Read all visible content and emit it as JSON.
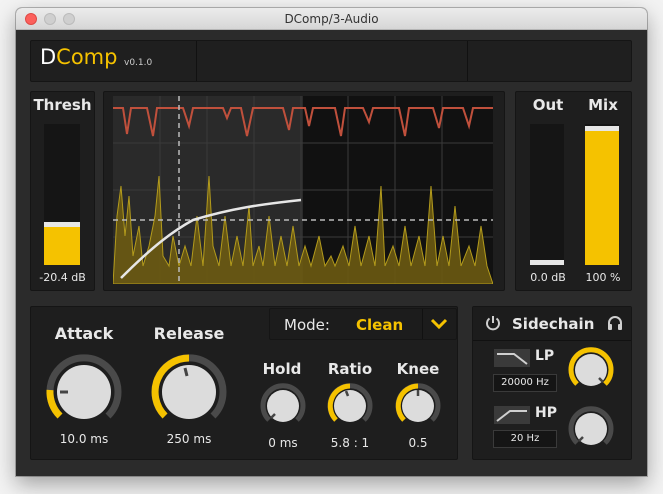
{
  "window": {
    "title": "DComp/3-Audio"
  },
  "header": {
    "brand_d": "D",
    "brand_comp": "Comp",
    "version": "v0.1.0"
  },
  "thresh": {
    "label": "Thresh",
    "value": "-20.4 dB",
    "level": 0.19
  },
  "out": {
    "label": "Out",
    "value": "0.0 dB",
    "level": 0.0
  },
  "mix": {
    "label": "Mix",
    "value": "100 %",
    "level": 1.0
  },
  "attack": {
    "label": "Attack",
    "value": "10.0 ms"
  },
  "release": {
    "label": "Release",
    "value": "250 ms"
  },
  "hold": {
    "label": "Hold",
    "value": "0 ms"
  },
  "ratio": {
    "label": "Ratio",
    "value": "5.8 : 1"
  },
  "knee": {
    "label": "Knee",
    "value": "0.5"
  },
  "mode": {
    "label": "Mode:",
    "value": "Clean"
  },
  "sidechain": {
    "label": "Sidechain",
    "lp_label": "LP",
    "lp_value": "20000 Hz",
    "hp_label": "HP",
    "hp_value": "20 Hz"
  },
  "colors": {
    "accent": "#f5c200",
    "gain_reduction": "#c0503c",
    "panel": "#1e1e1e",
    "background": "#2b2b2b"
  }
}
